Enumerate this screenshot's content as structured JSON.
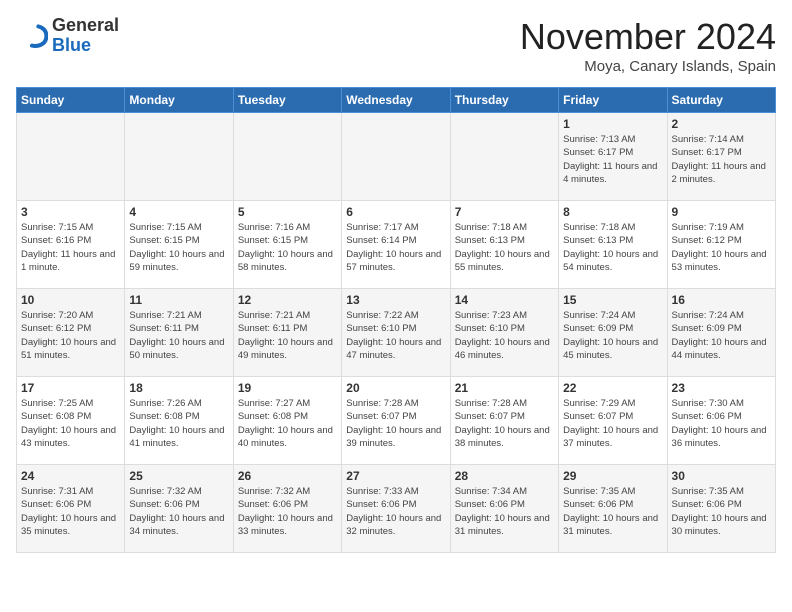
{
  "logo": {
    "general": "General",
    "blue": "Blue"
  },
  "title": "November 2024",
  "location": "Moya, Canary Islands, Spain",
  "days_of_week": [
    "Sunday",
    "Monday",
    "Tuesday",
    "Wednesday",
    "Thursday",
    "Friday",
    "Saturday"
  ],
  "weeks": [
    [
      {
        "day": "",
        "info": ""
      },
      {
        "day": "",
        "info": ""
      },
      {
        "day": "",
        "info": ""
      },
      {
        "day": "",
        "info": ""
      },
      {
        "day": "",
        "info": ""
      },
      {
        "day": "1",
        "info": "Sunrise: 7:13 AM\nSunset: 6:17 PM\nDaylight: 11 hours\nand 4 minutes."
      },
      {
        "day": "2",
        "info": "Sunrise: 7:14 AM\nSunset: 6:17 PM\nDaylight: 11 hours\nand 2 minutes."
      }
    ],
    [
      {
        "day": "3",
        "info": "Sunrise: 7:15 AM\nSunset: 6:16 PM\nDaylight: 11 hours\nand 1 minute."
      },
      {
        "day": "4",
        "info": "Sunrise: 7:15 AM\nSunset: 6:15 PM\nDaylight: 10 hours\nand 59 minutes."
      },
      {
        "day": "5",
        "info": "Sunrise: 7:16 AM\nSunset: 6:15 PM\nDaylight: 10 hours\nand 58 minutes."
      },
      {
        "day": "6",
        "info": "Sunrise: 7:17 AM\nSunset: 6:14 PM\nDaylight: 10 hours\nand 57 minutes."
      },
      {
        "day": "7",
        "info": "Sunrise: 7:18 AM\nSunset: 6:13 PM\nDaylight: 10 hours\nand 55 minutes."
      },
      {
        "day": "8",
        "info": "Sunrise: 7:18 AM\nSunset: 6:13 PM\nDaylight: 10 hours\nand 54 minutes."
      },
      {
        "day": "9",
        "info": "Sunrise: 7:19 AM\nSunset: 6:12 PM\nDaylight: 10 hours\nand 53 minutes."
      }
    ],
    [
      {
        "day": "10",
        "info": "Sunrise: 7:20 AM\nSunset: 6:12 PM\nDaylight: 10 hours\nand 51 minutes."
      },
      {
        "day": "11",
        "info": "Sunrise: 7:21 AM\nSunset: 6:11 PM\nDaylight: 10 hours\nand 50 minutes."
      },
      {
        "day": "12",
        "info": "Sunrise: 7:21 AM\nSunset: 6:11 PM\nDaylight: 10 hours\nand 49 minutes."
      },
      {
        "day": "13",
        "info": "Sunrise: 7:22 AM\nSunset: 6:10 PM\nDaylight: 10 hours\nand 47 minutes."
      },
      {
        "day": "14",
        "info": "Sunrise: 7:23 AM\nSunset: 6:10 PM\nDaylight: 10 hours\nand 46 minutes."
      },
      {
        "day": "15",
        "info": "Sunrise: 7:24 AM\nSunset: 6:09 PM\nDaylight: 10 hours\nand 45 minutes."
      },
      {
        "day": "16",
        "info": "Sunrise: 7:24 AM\nSunset: 6:09 PM\nDaylight: 10 hours\nand 44 minutes."
      }
    ],
    [
      {
        "day": "17",
        "info": "Sunrise: 7:25 AM\nSunset: 6:08 PM\nDaylight: 10 hours\nand 43 minutes."
      },
      {
        "day": "18",
        "info": "Sunrise: 7:26 AM\nSunset: 6:08 PM\nDaylight: 10 hours\nand 41 minutes."
      },
      {
        "day": "19",
        "info": "Sunrise: 7:27 AM\nSunset: 6:08 PM\nDaylight: 10 hours\nand 40 minutes."
      },
      {
        "day": "20",
        "info": "Sunrise: 7:28 AM\nSunset: 6:07 PM\nDaylight: 10 hours\nand 39 minutes."
      },
      {
        "day": "21",
        "info": "Sunrise: 7:28 AM\nSunset: 6:07 PM\nDaylight: 10 hours\nand 38 minutes."
      },
      {
        "day": "22",
        "info": "Sunrise: 7:29 AM\nSunset: 6:07 PM\nDaylight: 10 hours\nand 37 minutes."
      },
      {
        "day": "23",
        "info": "Sunrise: 7:30 AM\nSunset: 6:06 PM\nDaylight: 10 hours\nand 36 minutes."
      }
    ],
    [
      {
        "day": "24",
        "info": "Sunrise: 7:31 AM\nSunset: 6:06 PM\nDaylight: 10 hours\nand 35 minutes."
      },
      {
        "day": "25",
        "info": "Sunrise: 7:32 AM\nSunset: 6:06 PM\nDaylight: 10 hours\nand 34 minutes."
      },
      {
        "day": "26",
        "info": "Sunrise: 7:32 AM\nSunset: 6:06 PM\nDaylight: 10 hours\nand 33 minutes."
      },
      {
        "day": "27",
        "info": "Sunrise: 7:33 AM\nSunset: 6:06 PM\nDaylight: 10 hours\nand 32 minutes."
      },
      {
        "day": "28",
        "info": "Sunrise: 7:34 AM\nSunset: 6:06 PM\nDaylight: 10 hours\nand 31 minutes."
      },
      {
        "day": "29",
        "info": "Sunrise: 7:35 AM\nSunset: 6:06 PM\nDaylight: 10 hours\nand 31 minutes."
      },
      {
        "day": "30",
        "info": "Sunrise: 7:35 AM\nSunset: 6:06 PM\nDaylight: 10 hours\nand 30 minutes."
      }
    ]
  ]
}
